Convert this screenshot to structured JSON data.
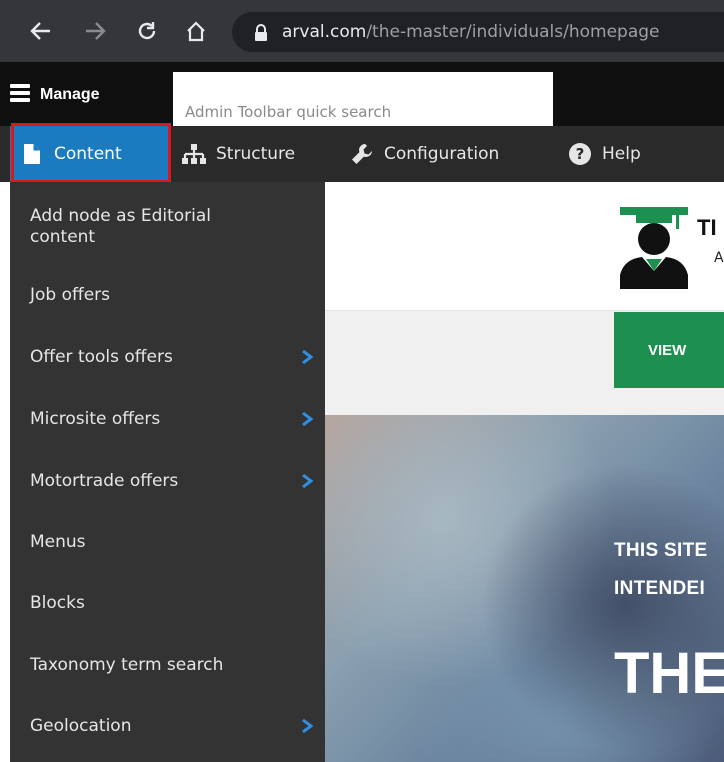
{
  "browser": {
    "url_domain": "arval.com",
    "url_path": "/the-master/individuals/homepage"
  },
  "toolbar": {
    "manage_label": "Manage",
    "search_placeholder": "Admin Toolbar quick search",
    "tray": [
      {
        "label": "Content",
        "icon": "page-icon"
      },
      {
        "label": "Structure",
        "icon": "sitemap-icon"
      },
      {
        "label": "Configuration",
        "icon": "wrench-icon"
      },
      {
        "label": "Help",
        "icon": "help-icon"
      }
    ]
  },
  "menu": {
    "items": [
      {
        "label": "Add node as Editorial\ncontent",
        "has_submenu": false
      },
      {
        "label": "Job offers",
        "has_submenu": false
      },
      {
        "label": "Offer tools offers",
        "has_submenu": true
      },
      {
        "label": "Microsite offers",
        "has_submenu": true
      },
      {
        "label": "Motortrade offers",
        "has_submenu": true
      },
      {
        "label": "Menus",
        "has_submenu": false
      },
      {
        "label": "Blocks",
        "has_submenu": false
      },
      {
        "label": "Taxonomy term search",
        "has_submenu": false
      },
      {
        "label": "Geolocation",
        "has_submenu": true
      }
    ]
  },
  "page": {
    "logo_text": "TI",
    "logo_sub": "A",
    "view_button": "VIEW",
    "hero_line1": "THIS SITE",
    "hero_line2": "INTENDEI",
    "hero_title": "THE"
  },
  "colors": {
    "accent_blue": "#1a7bc1",
    "highlight_red": "#e0151b",
    "menu_bg": "#333333",
    "chevron_blue": "#2f8fe0",
    "view_green": "#1d8f4e"
  }
}
